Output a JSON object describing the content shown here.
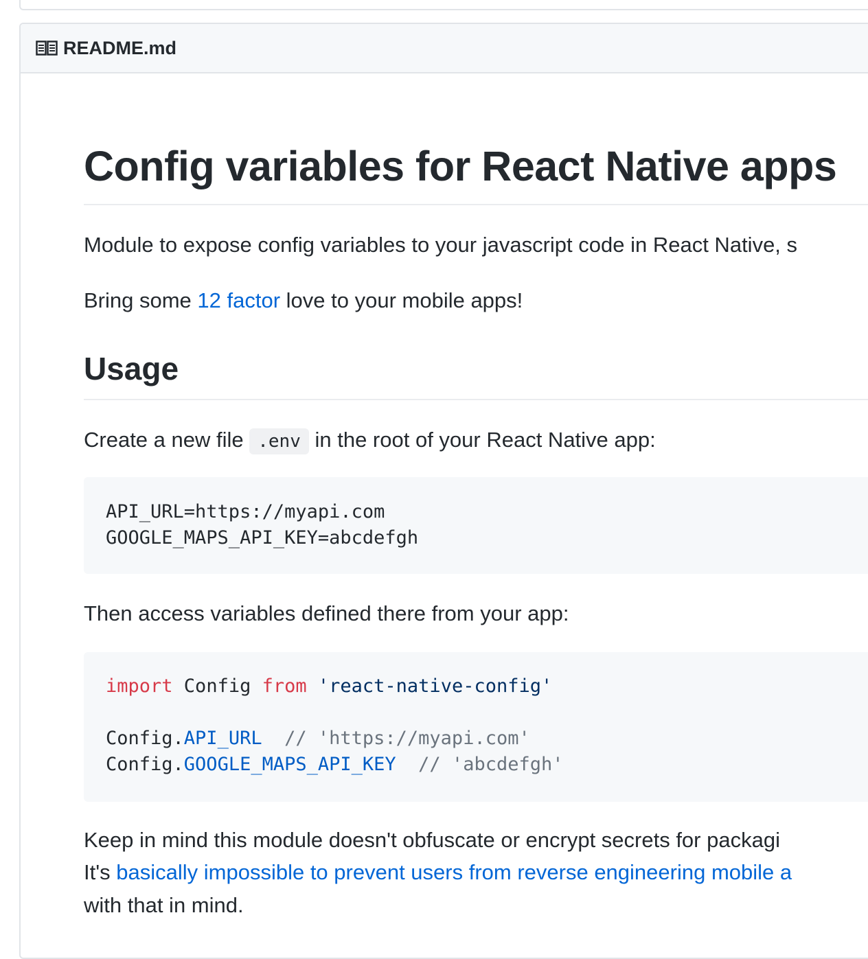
{
  "readme": {
    "filename": "README.md",
    "title": "Config variables for React Native apps",
    "intro": "Module to expose config variables to your javascript code in React Native, s",
    "bring_prefix": "Bring some ",
    "bring_link": "12 factor",
    "bring_suffix": " love to your mobile apps!",
    "usage_heading": "Usage",
    "create_prefix": "Create a new file ",
    "create_code": ".env",
    "create_suffix": " in the root of your React Native app:",
    "env_block": [
      "API_URL=https://myapi.com",
      "GOOGLE_MAPS_API_KEY=abcdefgh"
    ],
    "then_text": "Then access variables defined there from your app:",
    "js_block": {
      "import_kw": "import",
      "import_name": " Config ",
      "from_kw": "from",
      "import_module": " 'react-native-config'",
      "line2_obj": "Config.",
      "line2_prop": "API_URL",
      "line2_comment": "  // 'https://myapi.com'",
      "line3_obj": "Config.",
      "line3_prop": "GOOGLE_MAPS_API_KEY",
      "line3_comment": "  // 'abcdefgh'"
    },
    "keep_line1": "Keep in mind this module doesn't obfuscate or encrypt secrets for packagi",
    "keep_line2_prefix": "It's ",
    "keep_line2_link": "basically impossible to prevent users from reverse engineering mobile a",
    "keep_line3": "with that in mind."
  },
  "colors": {
    "link": "#0366d6",
    "keyword": "#d73a49",
    "string": "#032f62",
    "property": "#005cc5",
    "comment": "#6a737d"
  },
  "icons": {
    "readme": "book-icon"
  }
}
